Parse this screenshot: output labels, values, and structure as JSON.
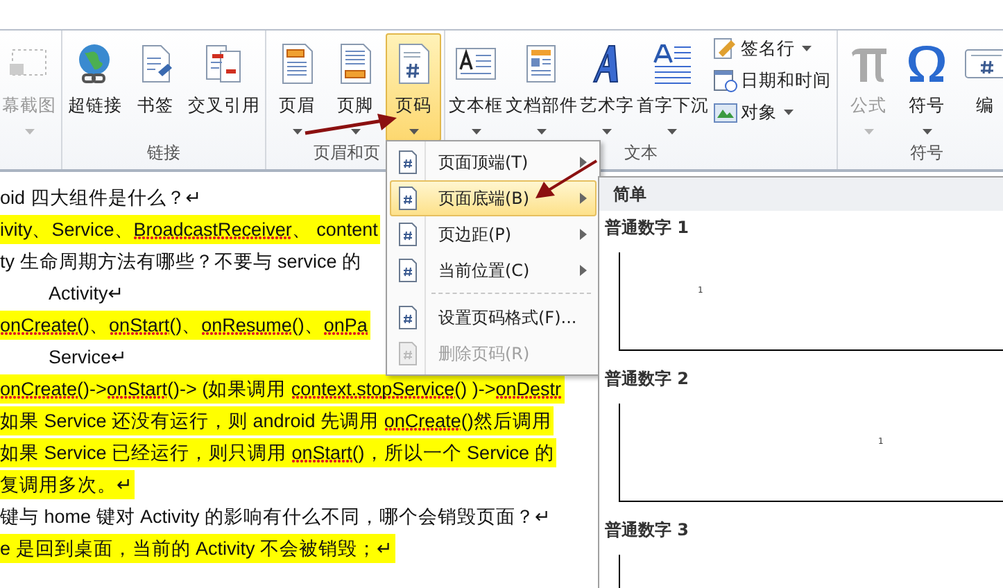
{
  "ribbon": {
    "groups": [
      {
        "buttons": [
          {
            "label": "幕截图",
            "disabled": true,
            "dropdown": true,
            "selected": false
          }
        ]
      },
      {
        "label": "链接",
        "buttons": [
          {
            "label": "超链接",
            "disabled": false,
            "dropdown": false,
            "selected": false
          },
          {
            "label": "书签",
            "disabled": false,
            "dropdown": false,
            "selected": false
          },
          {
            "label": "交叉引用",
            "disabled": false,
            "dropdown": false,
            "selected": false
          }
        ]
      },
      {
        "label": "页眉和页",
        "buttons": [
          {
            "label": "页眉",
            "disabled": false,
            "dropdown": true,
            "selected": false
          },
          {
            "label": "页脚",
            "disabled": false,
            "dropdown": true,
            "selected": false
          },
          {
            "label": "页码",
            "disabled": false,
            "dropdown": true,
            "selected": true
          }
        ]
      },
      {
        "label": "文本",
        "buttons": [
          {
            "label": "文本框",
            "disabled": false,
            "dropdown": true,
            "selected": false
          },
          {
            "label": "文档部件",
            "disabled": false,
            "dropdown": true,
            "selected": false
          },
          {
            "label": "艺术字",
            "disabled": false,
            "dropdown": true,
            "selected": false
          },
          {
            "label": "首字下沉",
            "disabled": false,
            "dropdown": true,
            "selected": false
          }
        ],
        "small_buttons": [
          {
            "label": "签名行",
            "dropdown": true
          },
          {
            "label": "日期和时间",
            "dropdown": false
          },
          {
            "label": "对象",
            "dropdown": true
          }
        ]
      },
      {
        "label": "符号",
        "buttons": [
          {
            "label": "公式",
            "disabled": true,
            "dropdown": true,
            "selected": false
          },
          {
            "label": "符号",
            "disabled": false,
            "dropdown": true,
            "selected": false
          },
          {
            "label": "编",
            "disabled": false,
            "dropdown": false,
            "selected": false
          }
        ]
      }
    ]
  },
  "page_number_menu": {
    "items": [
      {
        "kind": "item",
        "label": "页面顶端(T)",
        "submenu": true,
        "selected": false,
        "disabled": false
      },
      {
        "kind": "item",
        "label": "页面底端(B)",
        "submenu": true,
        "selected": true,
        "disabled": false
      },
      {
        "kind": "item",
        "label": "页边距(P)",
        "submenu": true,
        "selected": false,
        "disabled": false
      },
      {
        "kind": "item",
        "label": "当前位置(C)",
        "submenu": true,
        "selected": false,
        "disabled": false
      },
      {
        "kind": "separator"
      },
      {
        "kind": "item",
        "label": "设置页码格式(F)...",
        "submenu": false,
        "selected": false,
        "disabled": false
      },
      {
        "kind": "item",
        "label": "删除页码(R)",
        "submenu": false,
        "selected": false,
        "disabled": true
      }
    ]
  },
  "gallery": {
    "header": "简单",
    "items": [
      {
        "label": "普通数字 1",
        "number": "1"
      },
      {
        "label": "普通数字 2",
        "number": "1"
      },
      {
        "label": "普通数字 3"
      }
    ]
  },
  "document": {
    "paragraphs": [
      {
        "indent": false,
        "highlight": false,
        "segments": [
          {
            "text": "oid 四大组件是什么？↵",
            "misspelled": false
          }
        ]
      },
      {
        "indent": false,
        "highlight": true,
        "segments": [
          {
            "text": "ivity、Service、",
            "misspelled": false
          },
          {
            "text": "BroadcastReceiver",
            "misspelled": true
          },
          {
            "text": "、 content",
            "misspelled": false
          }
        ]
      },
      {
        "indent": false,
        "highlight": false,
        "segments": [
          {
            "text": "ty 生命周期方法有哪些？不要与 service 的",
            "misspelled": false
          }
        ]
      },
      {
        "indent": true,
        "highlight": false,
        "segments": [
          {
            "text": "Activity↵",
            "misspelled": false
          }
        ]
      },
      {
        "indent": false,
        "highlight": true,
        "segments": [
          {
            "text": "onCreate",
            "misspelled": true
          },
          {
            "text": "()、",
            "misspelled": false
          },
          {
            "text": "onStart",
            "misspelled": true
          },
          {
            "text": "()、",
            "misspelled": false
          },
          {
            "text": "onResume",
            "misspelled": true
          },
          {
            "text": "()、",
            "misspelled": false
          },
          {
            "text": "onPa",
            "misspelled": true
          }
        ]
      },
      {
        "indent": true,
        "highlight": false,
        "segments": [
          {
            "text": "Service↵",
            "misspelled": false
          }
        ]
      },
      {
        "indent": false,
        "highlight": true,
        "segments": [
          {
            "text": "onCreate",
            "misspelled": true
          },
          {
            "text": "()->",
            "misspelled": false
          },
          {
            "text": "onStart",
            "misspelled": true
          },
          {
            "text": "()-> (如果调用 ",
            "misspelled": false
          },
          {
            "text": "context.stopService",
            "misspelled": true
          },
          {
            "text": "() )->",
            "misspelled": false
          },
          {
            "text": "onDestr",
            "misspelled": true
          }
        ]
      },
      {
        "indent": false,
        "highlight": true,
        "segments": [
          {
            "text": "如果 Service 还没有运行，则 android 先调用 ",
            "misspelled": false
          },
          {
            "text": "onCreate",
            "misspelled": true
          },
          {
            "text": "()然后调用",
            "misspelled": false
          }
        ]
      },
      {
        "indent": false,
        "highlight": true,
        "segments": [
          {
            "text": "如果 Service 已经运行，则只调用 ",
            "misspelled": false
          },
          {
            "text": "onStart",
            "misspelled": true
          },
          {
            "text": "()，所以一个 Service 的",
            "misspelled": false
          }
        ]
      },
      {
        "indent": false,
        "highlight": true,
        "segments": [
          {
            "text": "复调用多次。↵",
            "misspelled": false
          }
        ]
      },
      {
        "indent": false,
        "highlight": false,
        "segments": [
          {
            "text": "键与 home 键对 Activity 的影响有什么不同，哪个会销毁页面？↵",
            "misspelled": false
          }
        ]
      },
      {
        "indent": false,
        "highlight": true,
        "segments": [
          {
            "text": "e 是回到桌面，当前的 Activity  不会被销毁；↵",
            "misspelled": false
          }
        ]
      }
    ]
  }
}
